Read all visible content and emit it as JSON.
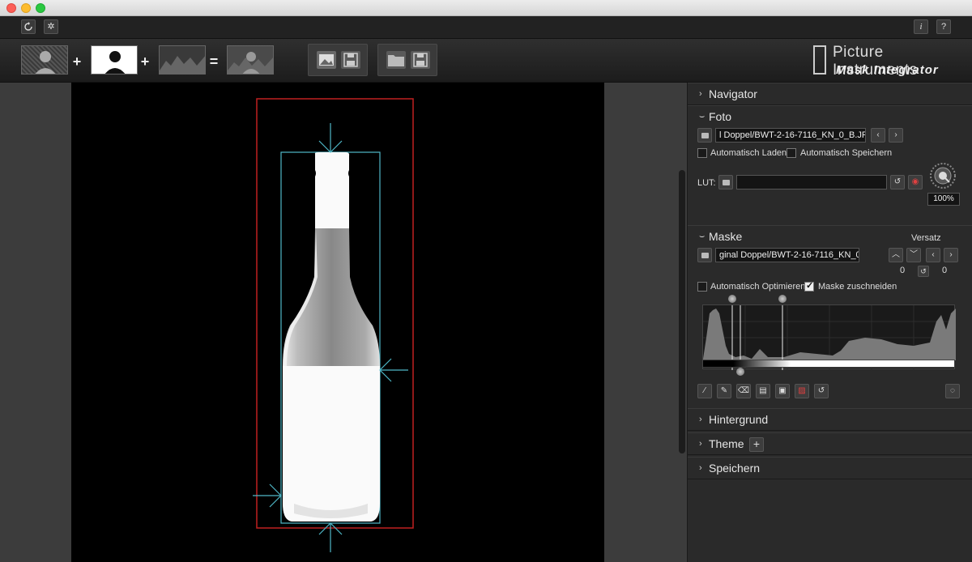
{
  "app": {
    "brand_line1": "Picture Instruments",
    "brand_line2": "Mask Integrator"
  },
  "topbar": {
    "reset_icon": "reset-icon",
    "settings_icon": "gear-icon",
    "info_label": "i",
    "help_label": "?"
  },
  "toolbar": {
    "plus1": "+",
    "plus2": "+",
    "equals": "="
  },
  "panel": {
    "navigator": {
      "title": "Navigator"
    },
    "foto": {
      "title": "Foto",
      "path": "l Doppel/BWT-2-16-7116_KN_0_B.JPG",
      "auto_load": "Automatisch Laden",
      "auto_save": "Automatisch Speichern",
      "lut_label": "LUT:",
      "lut_path": "",
      "zoom": "100%"
    },
    "maske": {
      "title": "Maske",
      "path": "ginal Doppel/BWT-2-16-7116_KN_0_M.JPG",
      "versatz_label": "Versatz",
      "versatz_v": "0",
      "versatz_h": "0",
      "auto_optimize": "Automatisch Optimieren",
      "crop_mask": "Maske zuschneiden"
    },
    "hintergrund": {
      "title": "Hintergrund"
    },
    "theme": {
      "title": "Theme",
      "add": "+"
    },
    "speichern": {
      "title": "Speichern"
    }
  },
  "colors": {
    "selection_box": "#c02020",
    "crop_box": "#4fb8c8"
  }
}
